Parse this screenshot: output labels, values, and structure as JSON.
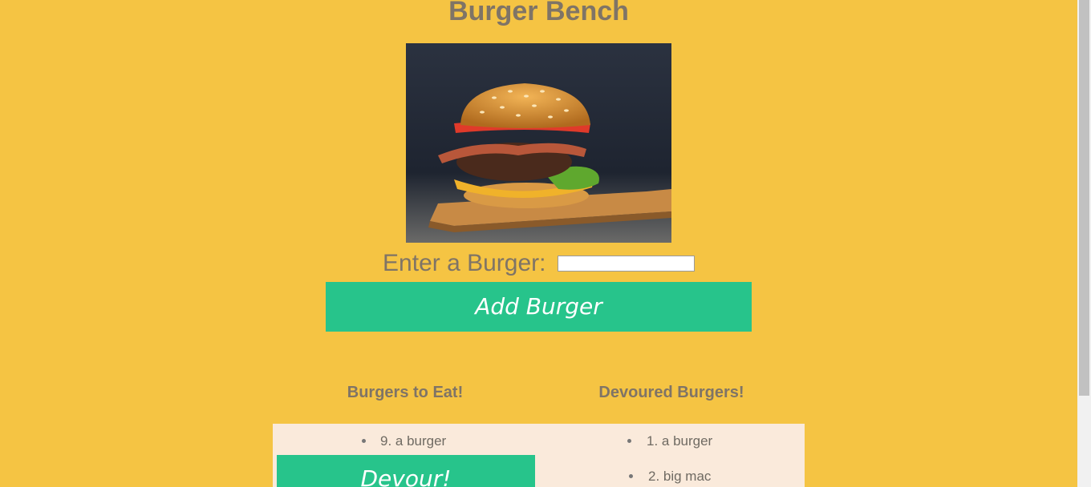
{
  "page": {
    "title": "Burger Bench"
  },
  "form": {
    "label": "Enter a Burger:",
    "input_value": "",
    "button_label": "Add Burger"
  },
  "columns": {
    "to_eat": {
      "heading": "Burgers to Eat!",
      "items": [
        {
          "text": "9. a burger",
          "button": "Devour!"
        }
      ]
    },
    "devoured": {
      "heading": "Devoured Burgers!",
      "items": [
        {
          "text": "1. a burger"
        },
        {
          "text": "2. big mac"
        }
      ]
    }
  },
  "colors": {
    "background": "#f5c443",
    "accent": "#27c48b",
    "panel": "#faeadb",
    "text": "#7f7466"
  }
}
